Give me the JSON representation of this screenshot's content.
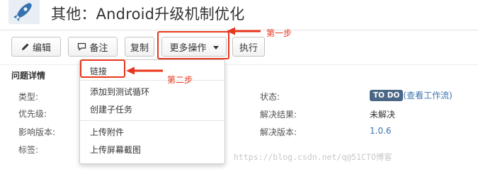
{
  "header": {
    "title": "其他：Android升级机制优化"
  },
  "toolbar": {
    "edit_label": "编辑",
    "comment_label": "备注",
    "copy_label": "复制",
    "more_label": "更多操作",
    "execute_label": "执行"
  },
  "annotations": {
    "step1": "第一步",
    "step2": "第二步",
    "color": "#e8361c"
  },
  "details": {
    "section_title": "问题详情",
    "left": [
      {
        "label": "类型:"
      },
      {
        "label": "优先级:"
      },
      {
        "label": "影响版本:"
      },
      {
        "label": "标签:"
      }
    ],
    "right": [
      {
        "label": "状态:",
        "badge": "TO DO",
        "link": "(查看工作流)"
      },
      {
        "label": "解决结果:",
        "value": "未解决"
      },
      {
        "label": "解决版本:",
        "value": "1.0.6"
      }
    ]
  },
  "dropdown": {
    "items": [
      "链接",
      "添加到测试循环",
      "创建子任务",
      "上传附件",
      "上传屏幕截图"
    ]
  },
  "watermark": "https://blog.csdn.net/q@51CTO博客",
  "colors": {
    "link": "#3b73af",
    "badge_bg": "#4a6785"
  },
  "icons": {
    "project": "rocket-icon",
    "edit": "pencil-icon",
    "comment": "comment-icon"
  }
}
